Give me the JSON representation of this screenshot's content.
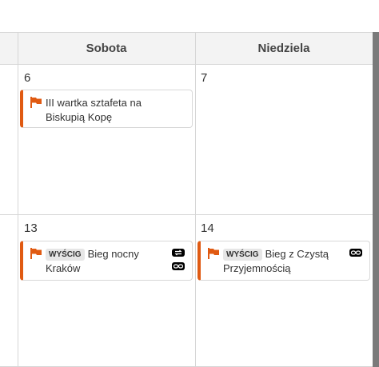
{
  "header": {
    "days": [
      "Sobota",
      "Niedziela"
    ]
  },
  "weeks": [
    {
      "days": [
        {
          "number": "6",
          "events": [
            {
              "text": "III wartka sztafeta na Biskupią Kopę"
            }
          ]
        },
        {
          "number": "7",
          "events": []
        }
      ]
    },
    {
      "days": [
        {
          "number": "13",
          "events": [
            {
              "badge": "WYŚCIG",
              "text": "Bieg nocny Kraków",
              "icons": [
                "swap-icon",
                "link-icon"
              ]
            }
          ]
        },
        {
          "number": "14",
          "events": [
            {
              "badge": "WYŚCIG",
              "text": "Bieg z Czystą Przyjemnością",
              "icons": [
                "link-icon"
              ]
            }
          ]
        }
      ]
    }
  ],
  "colors": {
    "accent": "#e05a12",
    "header_bg": "#f3f3f3",
    "grid": "#d6d6d6",
    "scrollbar": "#7a7a7a",
    "badge_bg": "#e6e6e6"
  }
}
